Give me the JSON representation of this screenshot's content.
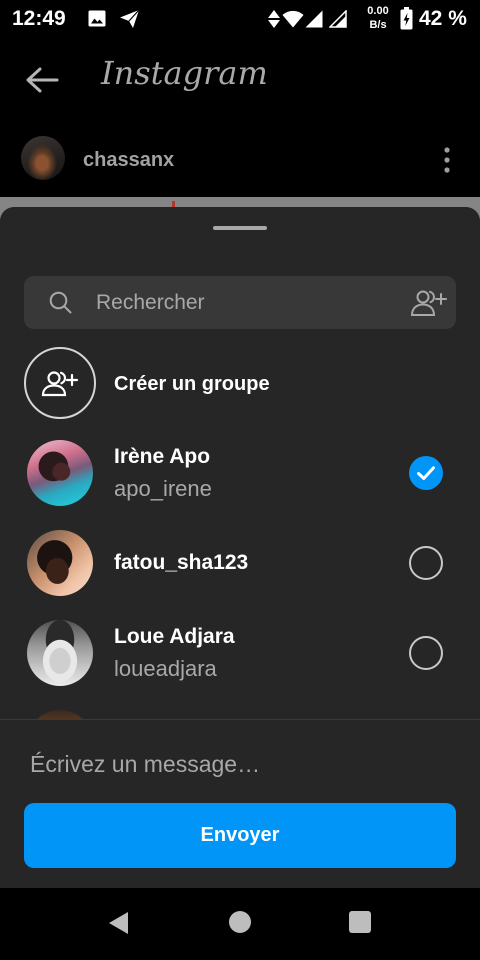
{
  "status_bar": {
    "time": "12:49",
    "speed_value": "0.00",
    "speed_unit": "B/s",
    "battery_percent": "42 %",
    "left_icons": [
      "gallery-icon",
      "send-icon"
    ],
    "right_icons": [
      "data-activity-icon",
      "wifi-icon",
      "signal-icon",
      "signal-icon",
      "battery-charging-icon"
    ]
  },
  "header": {
    "logo": "Instagram",
    "back_icon": "back-arrow-icon"
  },
  "post": {
    "username": "chassanx",
    "menu_icon": "more-vertical-icon"
  },
  "share_sheet": {
    "search": {
      "placeholder": "Rechercher",
      "icon": "search-icon",
      "action_icon": "add-people-icon"
    },
    "create_group": {
      "label": "Créer un groupe",
      "icon": "group-add-icon"
    },
    "contacts": [
      {
        "name": "Irène Apo",
        "username": "apo_irene",
        "selected": true
      },
      {
        "name": "fatou_sha123",
        "selected": false
      },
      {
        "name": "Loue Adjara",
        "username": "loueadjara",
        "selected": false
      }
    ],
    "message": {
      "placeholder": "Écrivez un message…"
    },
    "send_button": {
      "label": "Envoyer"
    }
  },
  "colors": {
    "accent": "#0095F6",
    "sheet_background": "#262626",
    "page_background": "#000000"
  },
  "nav_bar": {
    "icons": [
      "nav-back-icon",
      "nav-home-icon",
      "nav-recents-icon"
    ]
  }
}
